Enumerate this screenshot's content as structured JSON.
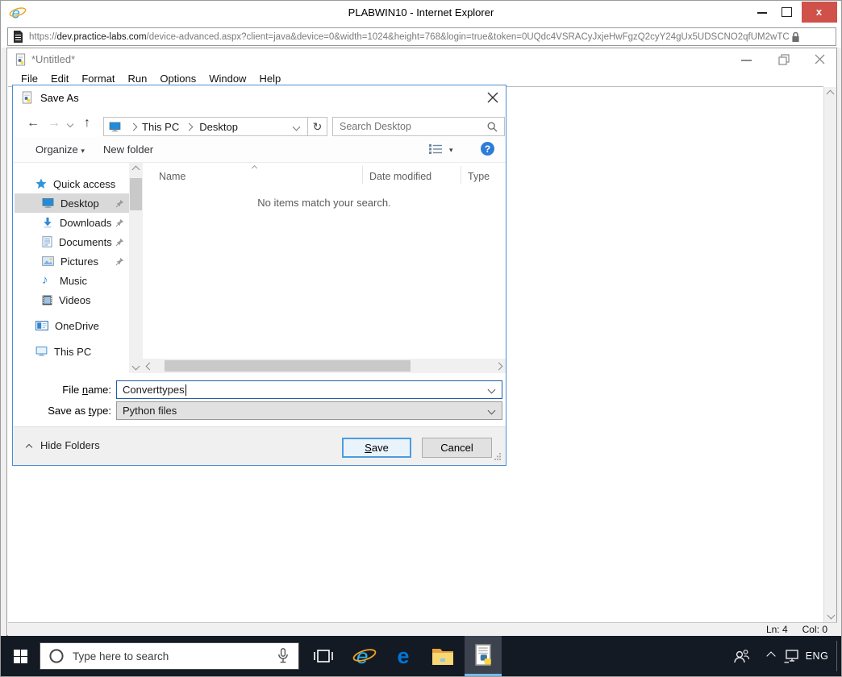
{
  "colors": {
    "accent_blue": "#0078d7",
    "dialog_border": "#4a8ed5",
    "close_red": "#d0504a",
    "taskbar_bg": "#141a24",
    "selection_gray": "#d9d9d9"
  },
  "ie_window": {
    "title": "PLABWIN10 - Internet Explorer",
    "url_scheme": "https://",
    "url_domain": "dev.practice-labs.com",
    "url_path": "/device-advanced.aspx?client=java&device=0&width=1024&height=768&login=true&token=0UQdc4VSRACyJxjeHwFgzQ2cyY24gUx5UDSCNO2qfUM2wTC"
  },
  "idle_window": {
    "title": "*Untitled*",
    "menu": [
      "File",
      "Edit",
      "Format",
      "Run",
      "Options",
      "Window",
      "Help"
    ],
    "status_line": "Ln: 4",
    "status_col": "Col: 0"
  },
  "save_dialog": {
    "title": "Save As",
    "breadcrumb_this_pc": "This PC",
    "breadcrumb_desktop": "Desktop",
    "search_placeholder": "Search Desktop",
    "organize_label": "Organize",
    "new_folder_label": "New folder",
    "columns": {
      "name": "Name",
      "date_modified": "Date modified",
      "type": "Type"
    },
    "empty_message": "No items match your search.",
    "sidebar": [
      {
        "label": "Quick access"
      },
      {
        "label": "Desktop"
      },
      {
        "label": "Downloads"
      },
      {
        "label": "Documents"
      },
      {
        "label": "Pictures"
      },
      {
        "label": "Music"
      },
      {
        "label": "Videos"
      },
      {
        "label": "OneDrive"
      },
      {
        "label": "This PC"
      }
    ],
    "file_name_label": {
      "pre": "File ",
      "key": "n",
      "post": "ame:"
    },
    "file_name_value": "Converttypes",
    "save_as_type_label": {
      "pre": "Save as ",
      "key": "t",
      "post": "ype:"
    },
    "save_as_type_value": "Python files",
    "hide_folders_label": "Hide Folders",
    "save_button": {
      "key": "S",
      "post": "ave"
    },
    "cancel_button": "Cancel"
  },
  "taskbar": {
    "search_placeholder": "Type here to search",
    "language": "ENG"
  }
}
